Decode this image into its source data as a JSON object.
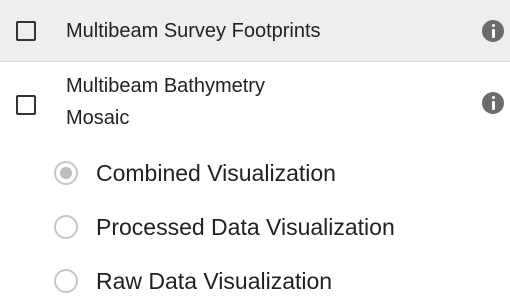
{
  "layers": [
    {
      "label": "Multibeam Survey Footprints",
      "checked": false,
      "icon": "info-icon"
    },
    {
      "label": "Multibeam Bathymetry Mosaic",
      "checked": false,
      "icon": "info-icon"
    }
  ],
  "visualization_options": [
    {
      "label": "Combined Visualization",
      "selected": true
    },
    {
      "label": "Processed Data Visualization",
      "selected": false
    },
    {
      "label": "Raw Data Visualization",
      "selected": false
    }
  ],
  "colors": {
    "selected_row_bg": "#eeeeee",
    "info_icon": "#6b6b6b",
    "radio_border": "#c7c7c7",
    "radio_dot": "#bdbdbd",
    "text": "#212121"
  }
}
